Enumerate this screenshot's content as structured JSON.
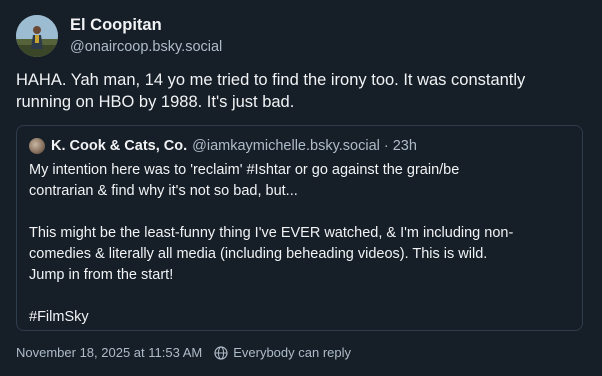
{
  "post": {
    "author": {
      "display_name": "El Coopitan",
      "handle": "@onaircoop.bsky.social"
    },
    "text": "HAHA. Yah man, 14 yo me tried to find the irony too. It was constantly\nrunning on HBO by 1988. It's just bad.",
    "quote": {
      "author_name": "K. Cook & Cats, Co.",
      "author_handle": "@iamkaymichelle.bsky.social",
      "separator": "·",
      "time": "23h",
      "text": "My intention here was to 'reclaim' #Ishtar or go against the grain/be\ncontrarian & find why it's not so bad, but...\n\nThis might be the least-funny thing I've EVER watched, & I'm including non-\ncomedies & literally all media (including beheading videos). This is wild.\nJump in from the start!\n\n#FilmSky"
    },
    "timestamp": "November 18, 2025 at 11:53 AM",
    "reply_setting": "Everybody can reply"
  },
  "colors": {
    "background": "#161e27",
    "text_primary": "#f1f3f5",
    "text_secondary": "#aebbc9",
    "border": "#2e3c4c"
  },
  "icons": {
    "reply_setting_icon": "globe-icon"
  }
}
